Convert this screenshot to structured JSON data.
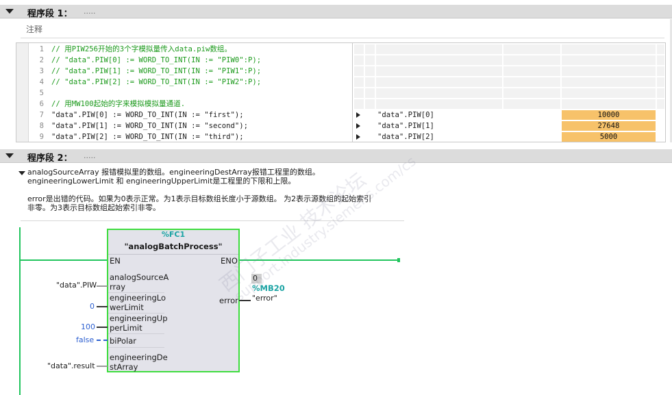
{
  "network1": {
    "title": "程序段 1：",
    "dots": ".....",
    "comment": "注释",
    "code_lines": [
      {
        "num": "1",
        "text": "// 用PIW256开始的3个字模拟量传入data.piw数组。",
        "type": "comment"
      },
      {
        "num": "2",
        "text": "// \"data\".PIW[0] := WORD_TO_INT(IN := \"PIW0\":P);",
        "type": "comment"
      },
      {
        "num": "3",
        "text": "// \"data\".PIW[1] := WORD_TO_INT(IN := \"PIW1\":P);",
        "type": "comment"
      },
      {
        "num": "4",
        "text": "// \"data\".PIW[2] := WORD_TO_INT(IN := \"PIW2\":P);",
        "type": "comment"
      },
      {
        "num": "5",
        "text": "",
        "type": "code"
      },
      {
        "num": "6",
        "text": "// 用MW100起始的字来模拟模拟量通道.",
        "type": "comment"
      },
      {
        "num": "7",
        "text": "\"data\".PIW[0] := WORD_TO_INT(IN := \"first\");",
        "type": "code"
      },
      {
        "num": "8",
        "text": "\"data\".PIW[1] := WORD_TO_INT(IN := \"second\");",
        "type": "code"
      },
      {
        "num": "9",
        "text": "\"data\".PIW[2] := WORD_TO_INT(IN := \"third\");",
        "type": "code"
      }
    ],
    "watch": [
      {
        "name": "\"data\".PIW[0]",
        "value": "10000"
      },
      {
        "name": "\"data\".PIW[1]",
        "value": "27648"
      },
      {
        "name": "\"data\".PIW[2]",
        "value": "5000"
      }
    ]
  },
  "network2": {
    "title": "程序段 2：",
    "dots": ".....",
    "comment_lines": [
      "analogSourceArray 报错模拟里的数组。engineeringDestArray报错工程里的数组。",
      "engineeringLowerLimit 和 engineeringUpperLimit是工程里的下限和上限。",
      "",
      "error是出错的代码。如果为0表示正常。为1表示目标数组长度小于源数组。 为2表示源数组的起始索引",
      "非零。为3表示目标数组起始索引非零。"
    ],
    "block": {
      "number": "%FC1",
      "name": "\"analogBatchProcess\"",
      "en": "EN",
      "eno": "ENO",
      "pins_in": [
        {
          "label1": "analogSourceA",
          "label2": "rray",
          "operand": "\"data\".PIW"
        },
        {
          "label1": "engineeringLo",
          "label2": "werLimit",
          "operand": "0"
        },
        {
          "label1": "engineeringUp",
          "label2": "perLimit",
          "operand": "100"
        },
        {
          "label1": "biPolar",
          "label2": "",
          "operand": "false"
        },
        {
          "label1": "engineeringDe",
          "label2": "stArray",
          "operand": "\"data\".result"
        }
      ],
      "pin_out": {
        "label": "error",
        "operand": "\"error\"",
        "address": "%MB20",
        "monitor_value": "0"
      }
    }
  },
  "watermark": {
    "line1": "西门子工业  技术论坛",
    "line2": "support.industry.siemens.com/cs"
  },
  "colors": {
    "power_flow": "#22c55e",
    "block_border": "#3ddc3d",
    "watch_value_bg": "#f7c26a",
    "comment_green": "#1c9a1c",
    "address_teal": "#1aa3a3",
    "constant_blue": "#2c5fd0"
  }
}
